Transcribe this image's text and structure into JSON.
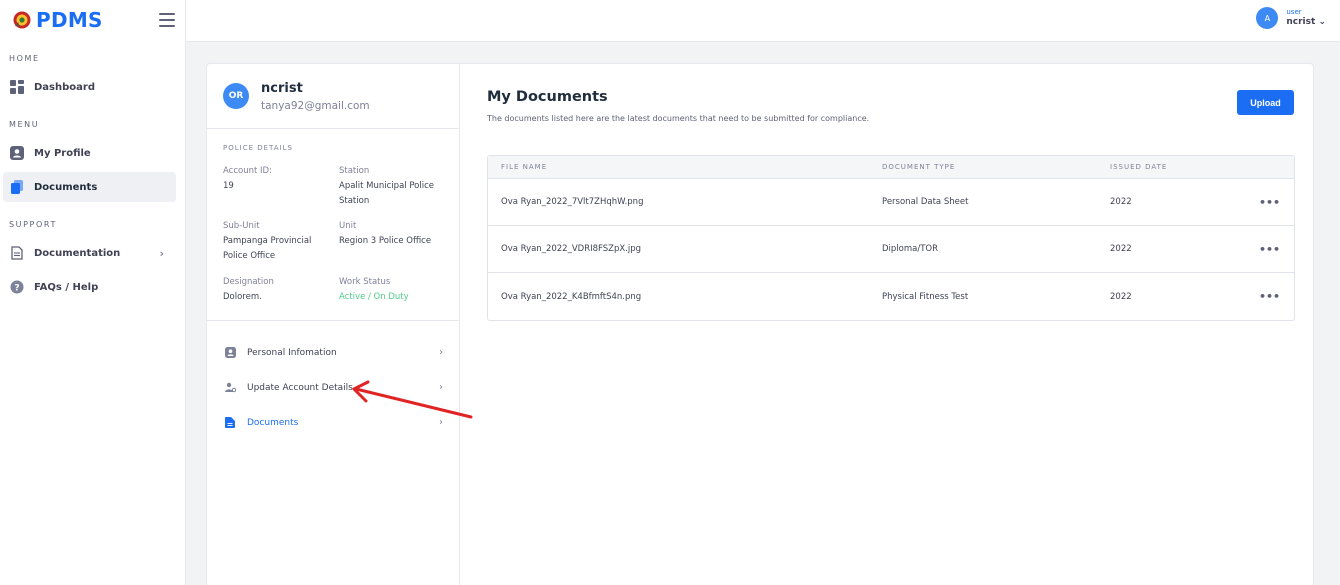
{
  "brand": {
    "name": "PDMS"
  },
  "sidebar": {
    "sections": {
      "home": "HOME",
      "menu": "MENU",
      "support": "SUPPORT"
    },
    "items": [
      {
        "label": "Dashboard",
        "icon": "dashboard-icon"
      },
      {
        "label": "My Profile",
        "icon": "user-icon"
      },
      {
        "label": "Documents",
        "icon": "documents-icon",
        "active": true
      },
      {
        "label": "Documentation",
        "icon": "file-icon",
        "chevron": "›"
      },
      {
        "label": "FAQs / Help",
        "icon": "help-icon"
      }
    ]
  },
  "topbar": {
    "avatar_initial": "A",
    "role": "user",
    "username": "ncrist",
    "chevron": "⌄"
  },
  "profile": {
    "initials": "OR",
    "name": "ncrist",
    "email": "tanya92@gmail.com",
    "details_title": "POLICE DETAILS",
    "fields": {
      "account_id": {
        "label": "Account ID:",
        "value": "19"
      },
      "station": {
        "label": "Station",
        "value": "Apalit Municipal Police Station"
      },
      "sub_unit": {
        "label": "Sub-Unit",
        "value": "Pampanga Provincial Police Office"
      },
      "unit": {
        "label": "Unit",
        "value": "Region 3 Police Office"
      },
      "designation": {
        "label": "Designation",
        "value": "Dolorem."
      },
      "work_status": {
        "label": "Work Status",
        "value": "Active / On Duty"
      }
    },
    "menu": [
      {
        "label": "Personal Infomation",
        "icon": "id-card-icon"
      },
      {
        "label": "Update Account Details",
        "icon": "user-settings-icon"
      },
      {
        "label": "Documents",
        "icon": "document-icon",
        "active": true
      }
    ]
  },
  "documents": {
    "title": "My Documents",
    "subtitle": "The documents listed here are the latest documents that need to be submitted for compliance.",
    "upload_label": "Upload",
    "columns": [
      "FILE NAME",
      "DOCUMENT TYPE",
      "ISSUED DATE"
    ],
    "rows": [
      {
        "file": "Ova Ryan_2022_7Vlt7ZHqhW.png",
        "type": "Personal Data Sheet",
        "date": "2022",
        "actions": "•••"
      },
      {
        "file": "Ova Ryan_2022_VDRI8FSZpX.jpg",
        "type": "Diploma/TOR",
        "date": "2022",
        "actions": "•••"
      },
      {
        "file": "Ova Ryan_2022_K4BfmftS4n.png",
        "type": "Physical Fitness Test",
        "date": "2022",
        "actions": "•••"
      }
    ]
  },
  "colors": {
    "primary": "#1b6ef3",
    "success": "#50cd89",
    "annotation": "#e02424"
  }
}
